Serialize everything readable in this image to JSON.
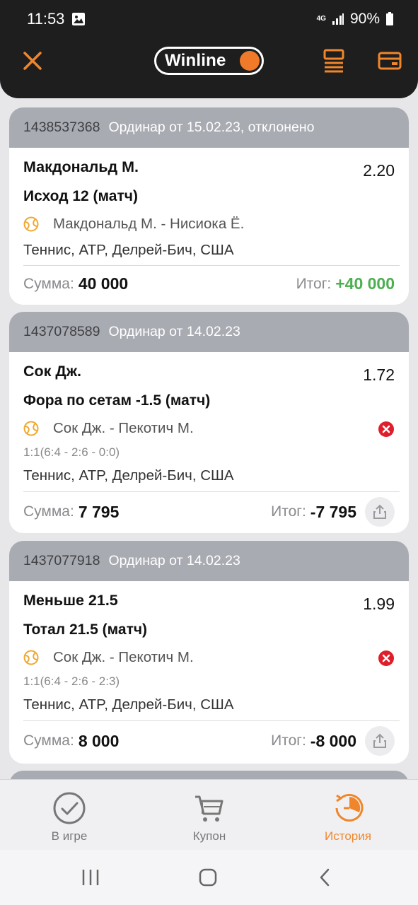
{
  "status_bar": {
    "time": "11:53",
    "network": "4G",
    "battery": "90%"
  },
  "header": {
    "logo_text": "Winline"
  },
  "bets": [
    {
      "id": "1438537368",
      "type": "Ординар от 15.02.23, отклонено",
      "selection": "Макдональд М.",
      "odds": "2.20",
      "market": "Исход 12 (матч)",
      "event": "Макдональд М. - Нисиока Ё.",
      "league": "Теннис,  ATP, Делрей-Бич, США",
      "stake_label": "Сумма:",
      "stake": "40 000",
      "result_label": "Итог:",
      "result": "+40 000"
    },
    {
      "id": "1437078589",
      "type": "Ординар от 14.02.23",
      "selection": "Сок Дж.",
      "odds": "1.72",
      "market": "Фора по сетам -1.5 (матч)",
      "event": "Сок Дж. - Пекотич М.",
      "score": "1:1(6:4 - 2:6 - 0:0)",
      "league": "Теннис,  ATP, Делрей-Бич, США",
      "stake_label": "Сумма:",
      "stake": "7 795",
      "result_label": "Итог:",
      "result": "-7 795"
    },
    {
      "id": "1437077918",
      "type": "Ординар от 14.02.23",
      "selection": "Меньше 21.5",
      "odds": "1.99",
      "market": "Тотал 21.5 (матч)",
      "event": "Сок Дж. - Пекотич М.",
      "score": "1:1(6:4 - 2:6 - 2:3)",
      "league": "Теннис,  ATP, Делрей-Бич, США",
      "stake_label": "Сумма:",
      "stake": "8 000",
      "result_label": "Итог:",
      "result": "-8 000"
    }
  ],
  "bottom_nav": [
    {
      "label": "В игре"
    },
    {
      "label": "Купон"
    },
    {
      "label": "История"
    }
  ],
  "colors": {
    "accent": "#f0862b",
    "win": "#4caf50",
    "loss": "#e01e2b",
    "header_bg": "#1e1e1e",
    "card_head": "#a9abb2"
  }
}
